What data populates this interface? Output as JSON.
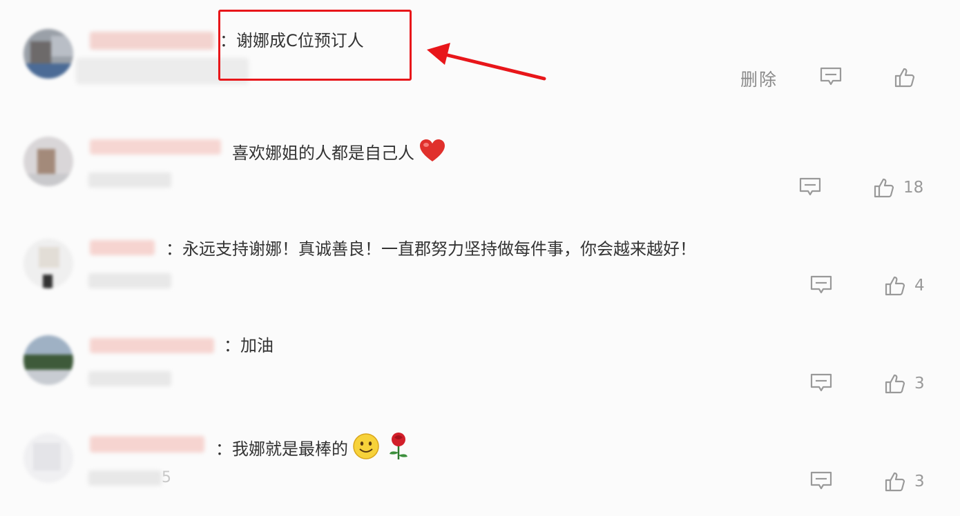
{
  "comments": [
    {
      "text": "：谢娜成C位预订人",
      "delete_label": "删除",
      "like_count": ""
    },
    {
      "text": "喜欢娜姐的人都是自己人",
      "emoji": "heart-icon",
      "like_count": "18"
    },
    {
      "text": "：永远支持谢娜！真诚善良！一直郡努力坚持做每件事，你会越来越好！",
      "like_count": "4"
    },
    {
      "text": "：加油",
      "like_count": "3"
    },
    {
      "text": "：我娜就是最棒的",
      "emoji": "smile-icon rose-icon",
      "like_count": "3",
      "meta_tail": "5"
    }
  ],
  "colors": {
    "highlight": "#e8161a",
    "action": "#999999",
    "heart": "#e0302c"
  }
}
